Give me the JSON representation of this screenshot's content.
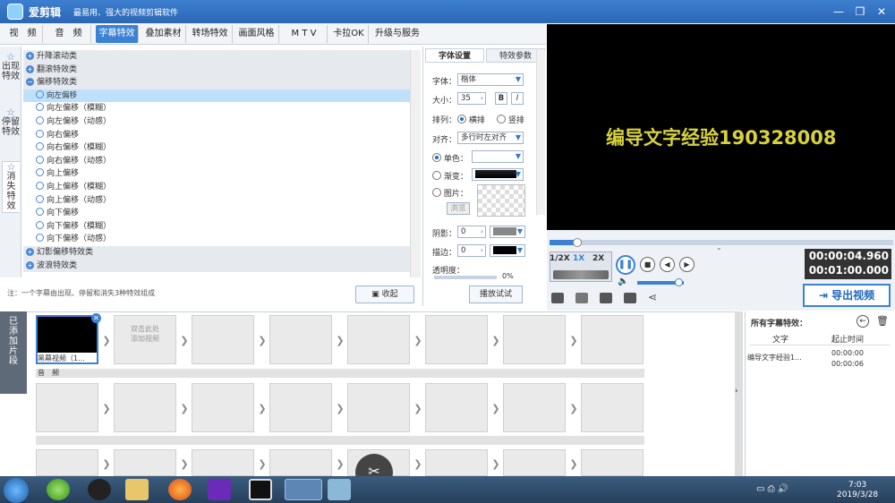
{
  "window": {
    "app_name": "爱剪辑",
    "slogan": "最易用、强大的视频剪辑软件"
  },
  "tabs": [
    "视　频",
    "音　频",
    "字幕特效",
    "叠加素材",
    "转场特效",
    "画面风格",
    "M T V",
    "卡拉OK",
    "升级与服务"
  ],
  "active_tab": "字幕特效",
  "side_categories": [
    {
      "label": "出现特效",
      "icon": "star-icon"
    },
    {
      "label": "停留特效",
      "icon": "star-icon"
    },
    {
      "label": "消失特效",
      "icon": "star-icon"
    }
  ],
  "effects_tree": [
    {
      "type": "cat",
      "label": "升降滚动类",
      "sign": "+"
    },
    {
      "type": "cat",
      "label": "翻滚特效类",
      "sign": "+"
    },
    {
      "type": "cat",
      "label": "偏移特效类",
      "sign": "−"
    },
    {
      "type": "item",
      "label": "向左偏移",
      "selected": true
    },
    {
      "type": "item",
      "label": "向左偏移（模糊）"
    },
    {
      "type": "item",
      "label": "向左偏移（动感）"
    },
    {
      "type": "item",
      "label": "向右偏移"
    },
    {
      "type": "item",
      "label": "向右偏移（模糊）"
    },
    {
      "type": "item",
      "label": "向右偏移（动感）"
    },
    {
      "type": "item",
      "label": "向上偏移"
    },
    {
      "type": "item",
      "label": "向上偏移（模糊）"
    },
    {
      "type": "item",
      "label": "向上偏移（动感）"
    },
    {
      "type": "item",
      "label": "向下偏移"
    },
    {
      "type": "item",
      "label": "向下偏移（模糊）"
    },
    {
      "type": "item",
      "label": "向下偏移（动感）"
    },
    {
      "type": "cat",
      "label": "幻影偏移特效类",
      "sign": "+"
    },
    {
      "type": "cat",
      "label": "波浪特效类",
      "sign": "+"
    }
  ],
  "note": "注：一个字幕由出现、停留和消失3种特效组成",
  "collapse_label": "收起",
  "play_test_label": "播放试试",
  "panel": {
    "tabs": [
      "字体设置",
      "特效参数"
    ],
    "font_label": "字体：",
    "font_value": "楷体",
    "size_label": "大小：",
    "size_value": "35",
    "bold": "B",
    "italic": "I",
    "layout_label": "排列：",
    "layout_h": "横排",
    "layout_v": "竖排",
    "align_label": "对齐：",
    "align_value": "多行时左对齐",
    "solid_label": "单色：",
    "gradient_label": "渐变：",
    "image_label": "图片：",
    "browse_label": "浏览",
    "shadow_label": "阴影：",
    "shadow_value": "0",
    "stroke_label": "描边：",
    "stroke_value": "0",
    "opacity_label": "透明度：",
    "opacity_value": "0%"
  },
  "preview": {
    "caption": "编导文字经验190328008"
  },
  "player": {
    "speeds": [
      "1/2X",
      "1X",
      "2X"
    ],
    "active_speed": "1X",
    "current_time": "00:00:04.960",
    "total_time": "00:01:00.000",
    "progress_fraction": 0.08,
    "volume_fraction": 0.9
  },
  "export_label": "导出视频",
  "timeline": {
    "added_label": "已添加片段",
    "first_clip_label": "黑幕视频（1...",
    "drop_hint": "双击此处\n添加视频",
    "audio_label": "音　频"
  },
  "effects_list": {
    "title": "所有字幕特效：",
    "col_text": "文字",
    "col_time": "起止时间",
    "rows": [
      {
        "text": "编导文字经验1...",
        "start": "00:00:00",
        "end": "00:00:06"
      }
    ]
  },
  "clock": {
    "time": "7:03",
    "date": "2019/3/28"
  },
  "colors": {
    "accent": "#3b82d4",
    "caption": "#d7d13c"
  }
}
